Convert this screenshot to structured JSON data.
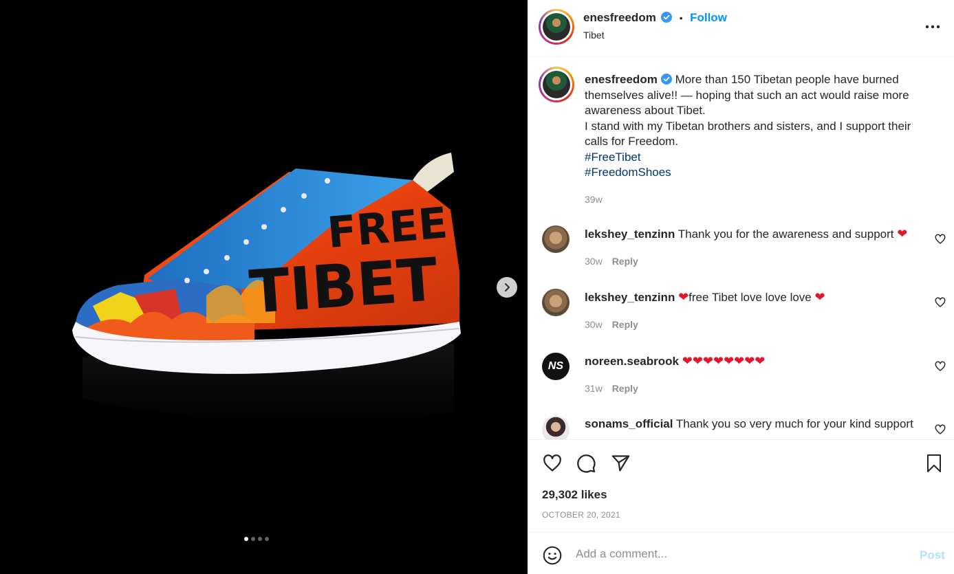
{
  "header": {
    "username": "enesfreedom",
    "separator": "•",
    "follow_label": "Follow",
    "location": "Tibet",
    "more_icon": "more-options-icon"
  },
  "caption": {
    "username": "enesfreedom",
    "text_1": "More than 150 Tibetan people have burned themselves alive!! — hoping that such an act would raise more awareness about Tibet.",
    "text_2": "I stand with my Tibetan brothers and sisters, and I support their calls for Freedom.",
    "hashtag_1": "#FreeTibet",
    "hashtag_2": "#FreedomShoes",
    "time": "39w"
  },
  "comments": [
    {
      "username": "lekshey_tenzinn",
      "text": "Thank you for the awareness and support",
      "emoji_after": "❤",
      "time": "30w",
      "reply": "Reply"
    },
    {
      "username": "lekshey_tenzinn",
      "emoji_before": "❤",
      "text": "free Tibet love love love",
      "emoji_after": "❤",
      "time": "30w",
      "reply": "Reply"
    },
    {
      "username": "noreen.seabrook",
      "text": "❤❤❤❤❤❤❤❤",
      "time": "31w",
      "reply": "Reply",
      "avatar_text": "NS"
    },
    {
      "username": "sonams_official",
      "text": "Thank you so very much for your kind support"
    }
  ],
  "actions": {
    "likes": "29,302 likes",
    "date": "OCTOBER 20, 2021"
  },
  "add_comment": {
    "placeholder": "Add a comment...",
    "post_label": "Post"
  },
  "media": {
    "shoe_text_1": "FREE",
    "shoe_text_2": "TIBET",
    "carousel_dots": 4,
    "active_dot": 1
  },
  "colors": {
    "link": "#0095f6",
    "hashtag": "#00376b",
    "muted": "#8e8e8e",
    "post_disabled": "#b2dffc"
  }
}
